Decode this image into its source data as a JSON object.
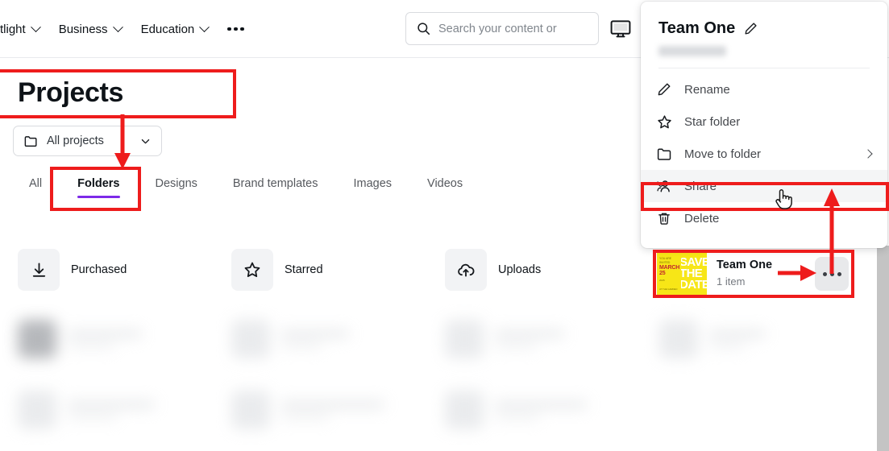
{
  "header": {
    "nav_items": [
      {
        "label": "tlight",
        "has_chevron": true
      },
      {
        "label": "Business",
        "has_chevron": true
      },
      {
        "label": "Education",
        "has_chevron": true
      }
    ],
    "more_icon": "ellipsis-icon",
    "search": {
      "placeholder": "Search your content or",
      "icon": "search-icon"
    },
    "desktop_icon": "monitor-icon"
  },
  "page": {
    "title": "Projects",
    "folder_filter": {
      "label": "All projects",
      "icon": "folder-icon",
      "chevron": "chevron-down-icon"
    },
    "tabs": [
      {
        "label": "All",
        "active": false
      },
      {
        "label": "Folders",
        "active": true
      },
      {
        "label": "Designs",
        "active": false
      },
      {
        "label": "Brand templates",
        "active": false
      },
      {
        "label": "Images",
        "active": false
      },
      {
        "label": "Videos",
        "active": false
      }
    ],
    "active_tab_color": "#7d2ae8"
  },
  "folder_cards": [
    {
      "label": "Purchased",
      "icon": "download-icon"
    },
    {
      "label": "Starred",
      "icon": "star-icon"
    },
    {
      "label": "Uploads",
      "icon": "cloud-upload-icon"
    }
  ],
  "team_folder": {
    "name": "Team One",
    "item_count": "1 item",
    "more_button_icon": "ellipsis-icon",
    "thumbnail": {
      "background_color": "#f7e617",
      "left_lines": [
        "YOU ARE INVITED",
        "MARCH",
        "25",
        "2025",
        "SAVE THE DATE",
        "AT THE GARDEN"
      ],
      "right_text_lines": [
        "SAVE",
        "THE",
        "DATE"
      ]
    }
  },
  "context_menu": {
    "title": "Team One",
    "title_edit_icon": "pencil-icon",
    "items": [
      {
        "label": "Rename",
        "icon": "pencil-icon",
        "highlighted": false,
        "submenu": false
      },
      {
        "label": "Star folder",
        "icon": "star-icon",
        "highlighted": false,
        "submenu": false
      },
      {
        "label": "Move to folder",
        "icon": "folder-icon",
        "highlighted": false,
        "submenu": true
      },
      {
        "label": "Share",
        "icon": "add-person-icon",
        "highlighted": true,
        "submenu": false
      },
      {
        "label": "Delete",
        "icon": "trash-icon",
        "highlighted": false,
        "submenu": false
      }
    ]
  },
  "annotations": {
    "highlight_color": "#ee1c1c",
    "boxes": [
      {
        "name": "projects-title-highlight"
      },
      {
        "name": "folders-tab-highlight"
      },
      {
        "name": "share-menu-item-highlight"
      },
      {
        "name": "team-one-card-highlight"
      }
    ],
    "arrows": [
      {
        "name": "arrow-title-to-folders-tab",
        "direction": "down"
      },
      {
        "name": "arrow-to-more-button",
        "direction": "right"
      },
      {
        "name": "arrow-more-to-share",
        "direction": "up"
      }
    ],
    "cursor": {
      "name": "hand-cursor",
      "over": "Share"
    }
  }
}
